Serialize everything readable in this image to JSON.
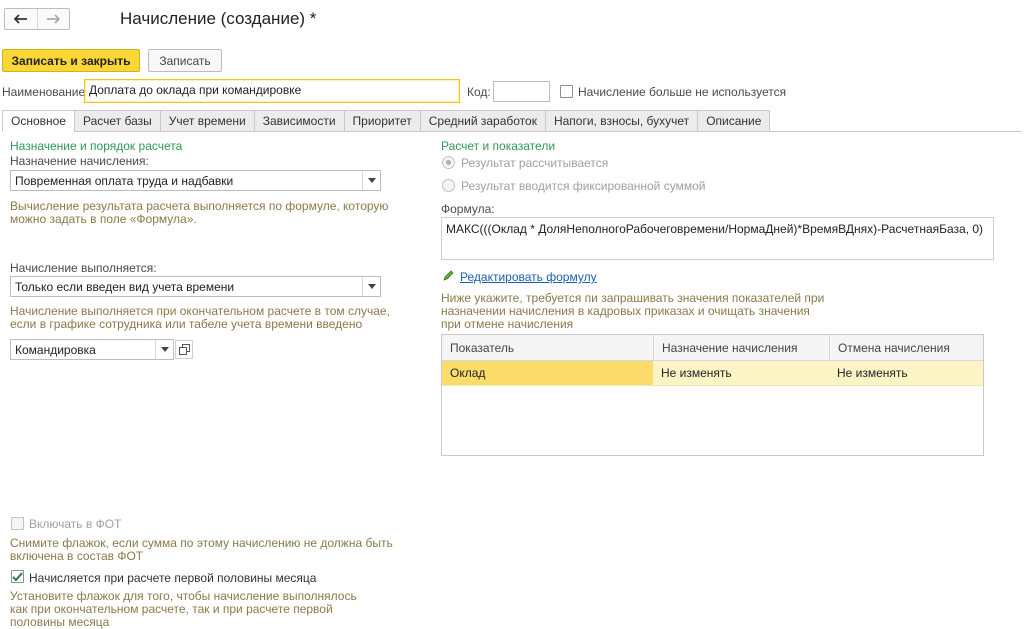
{
  "window": {
    "title": "Начисление (создание) *"
  },
  "toolbar": {
    "save_close_label": "Записать и закрыть",
    "save_label": "Записать"
  },
  "name_row": {
    "name_label": "Наименование:",
    "name_value": "Доплата до оклада при командировке",
    "code_label": "Код:",
    "code_value": "",
    "unused_checkbox_label": "Начисление больше не используется",
    "unused_checked": false
  },
  "tabs": [
    {
      "label": "Основное",
      "active": true
    },
    {
      "label": "Расчет базы"
    },
    {
      "label": "Учет времени"
    },
    {
      "label": "Зависимости"
    },
    {
      "label": "Приоритет"
    },
    {
      "label": "Средний заработок"
    },
    {
      "label": "Напоги, взносы, бухучет"
    },
    {
      "label": "Описание"
    }
  ],
  "left": {
    "section_title": "Назначение и порядок расчета",
    "purpose_label": "Назначение начисления:",
    "purpose_value": "Повременная оплата труда и надбавки",
    "purpose_hint_1": "Вычисление результата расчета выполняется по формуле, которую",
    "purpose_hint_2": "можно задать в поле «Формула».",
    "performed_label": "Начисление выполняется:",
    "performed_value": "Только если введен вид учета времени",
    "performed_hint_1": "Начисление выполняется при окончательном расчете в том случае,",
    "performed_hint_2": "если в графике сотрудника или табеле учета времени введено",
    "time_kind_value": "Командировка",
    "fot_checkbox_label": "Включать в ФОТ",
    "fot_checked": false,
    "fot_hint_1": "Снимите флажок, если сумма по этому начислению не должна быть",
    "fot_hint_2": "включена в состав ФОТ",
    "first_half_checkbox_label": "Начисляется при расчете первой половины месяца",
    "first_half_checked": true,
    "first_half_hint_1": "Установите флажок для того, чтобы начисление выполнялось",
    "first_half_hint_2": "как при окончательном расчете, так и при расчете первой",
    "first_half_hint_3": "половины месяца"
  },
  "right": {
    "section_title": "Расчет и показатели",
    "radio_calculated": "Результат рассчитывается",
    "radio_fixed": "Результат вводится фиксированной суммой",
    "formula_label": "Формула:",
    "formula_value": "МАКС(((Оклад * ДоляНеполногоРабочеговремени/НормаДней)*ВремяВДнях)-РасчетнаяБаза, 0)",
    "edit_formula_link": "Редактировать формулу",
    "indicators_hint_1": "Ниже укажите, требуется пи запрашивать значения показателей при",
    "indicators_hint_2": "назначении начисления в кадровых приказах и очищать значения",
    "indicators_hint_3": "при отмене начисления",
    "table": {
      "columns": [
        "Показатель",
        "Назначение начисления",
        "Отмена начисления"
      ],
      "rows": [
        [
          "Оклад",
          "Не изменять",
          "Не изменять"
        ]
      ]
    }
  },
  "colors": {
    "accent_yellow": "#fbd736",
    "section_green": "#2e9a52",
    "hint_text": "#8a7a4a",
    "link_blue": "#1b5fb0",
    "selected_row": "#fdf4c6"
  }
}
